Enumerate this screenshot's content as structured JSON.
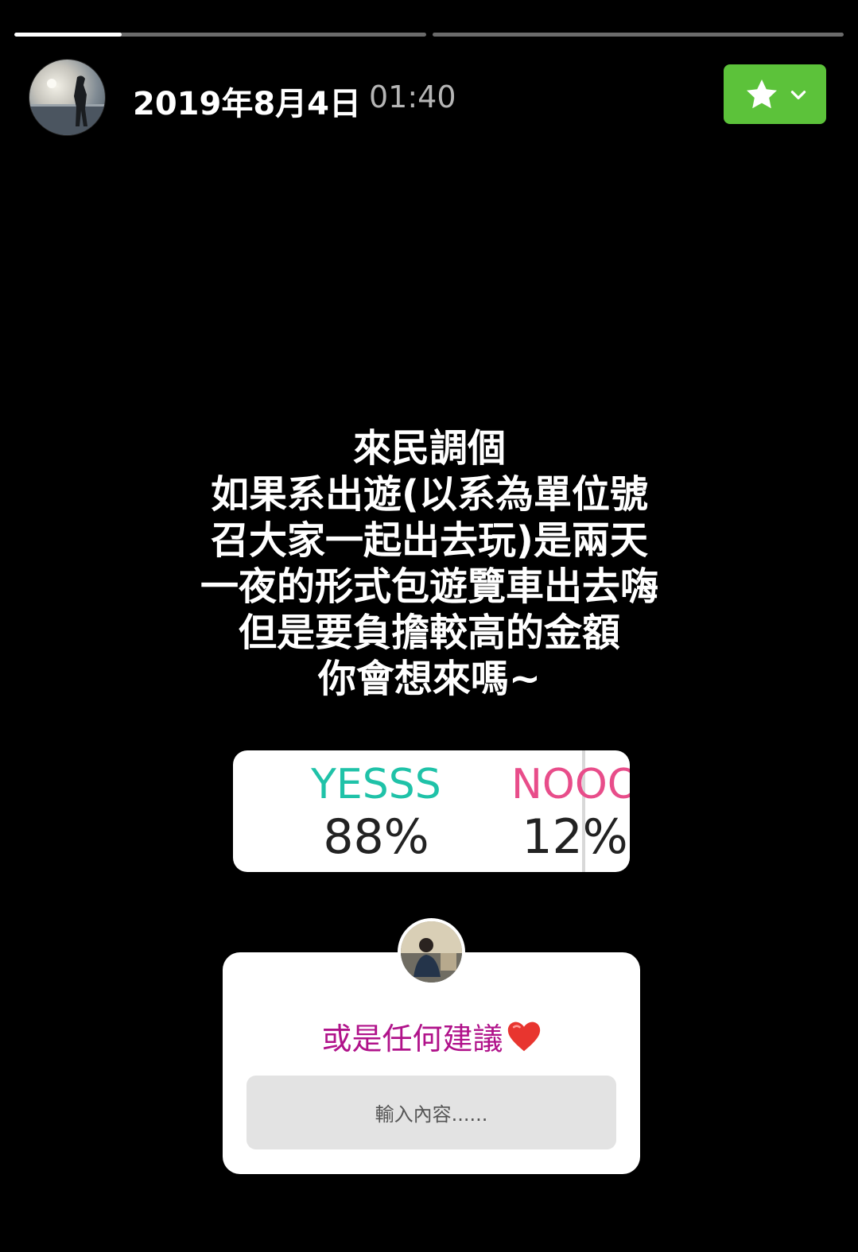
{
  "progress": {
    "segments": [
      {
        "fill_fraction": 0.26
      },
      {
        "fill_fraction": 0.0
      }
    ]
  },
  "header": {
    "date": "2019年8月4日",
    "time": "01:40",
    "favorite_button_color": "#5cc23a"
  },
  "question": {
    "lines": "來民調個\n如果系出遊(以系為單位號\n召大家一起出去玩)是兩天\n一夜的形式包遊覽車出去嗨\n但是要負擔較高的金額\n你會想來嗎~"
  },
  "poll": {
    "options": [
      {
        "label": "YESSS",
        "percent": "88%",
        "color": "#1fc2a8"
      },
      {
        "label": "NOOO",
        "percent": "12%",
        "color": "#e84d8a"
      }
    ],
    "yes_fraction": 0.88
  },
  "ask": {
    "prompt": "或是任何建議",
    "input_placeholder": "輸入內容......",
    "prompt_color": "#b0128a"
  },
  "icons": {
    "favorite": "star-icon",
    "dropdown": "chevron-down-icon",
    "prompt_emoji": "heart-icon"
  }
}
